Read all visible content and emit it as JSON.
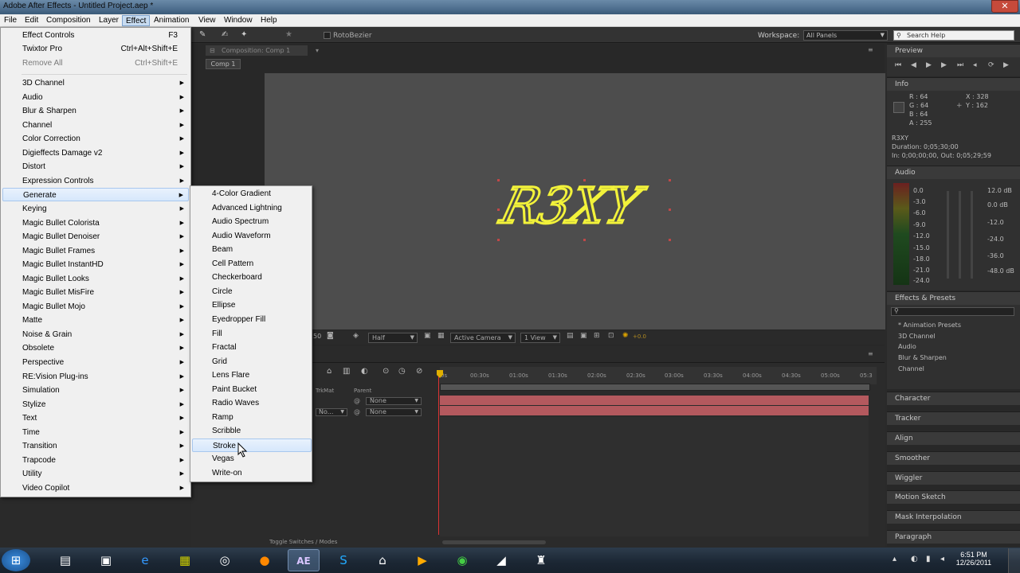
{
  "window": {
    "title": "Adobe After Effects - Untitled Project.aep *",
    "close": "✕"
  },
  "menubar": [
    "File",
    "Edit",
    "Composition",
    "Layer",
    "Effect",
    "Animation",
    "View",
    "Window",
    "Help"
  ],
  "toolbar": {
    "rotobezier": "RotoBezier",
    "workspace_label": "Workspace:",
    "workspace_value": "All Panels",
    "search_placeholder": "Search Help"
  },
  "comp": {
    "tab": "Composition: Comp 1",
    "breadcrumb": "Comp 1",
    "text": "R3XY"
  },
  "viewer_controls": {
    "resolution": "Half",
    "camera": "Active Camera",
    "views": "1 View",
    "exposure": "+0.0",
    "zoom": "50"
  },
  "timeline": {
    "ticks": [
      "0s",
      "00:30s",
      "01:00s",
      "01:30s",
      "02:00s",
      "02:30s",
      "03:00s",
      "03:30s",
      "04:00s",
      "04:30s",
      "05:00s",
      "05:3"
    ],
    "col_trkmat": "TrkMat",
    "col_parent": "Parent",
    "row1_parent": "None",
    "row2_mode": "No...",
    "row2_parent": "None",
    "toggle": "Toggle Switches / Modes"
  },
  "panels": {
    "preview": "Preview",
    "info": "Info",
    "info_rgb": [
      "R : 64",
      "G : 64",
      "B : 64",
      "A : 255"
    ],
    "info_xy": [
      "X : 328",
      "Y : 162"
    ],
    "info_layer": "R3XY",
    "info_duration": "Duration: 0;05;30;00",
    "info_inout": "In: 0;00;00;00, Out: 0;05;29;59",
    "audio": "Audio",
    "audio_left": [
      "0.0",
      "-3.0",
      "-6.0",
      "-9.0",
      "-12.0",
      "-15.0",
      "-18.0",
      "-21.0",
      "-24.0"
    ],
    "audio_right": [
      "12.0 dB",
      "0.0 dB",
      "-12.0",
      "-24.0",
      "-36.0",
      "-48.0 dB"
    ],
    "effects_presets": "Effects & Presets",
    "effects_list": [
      "* Animation Presets",
      "3D Channel",
      "Audio",
      "Blur & Sharpen",
      "Channel"
    ],
    "stacked": [
      "Character",
      "Tracker",
      "Align",
      "Smoother",
      "Wiggler",
      "Motion Sketch",
      "Mask Interpolation",
      "Paragraph"
    ]
  },
  "effect_menu": {
    "top": [
      {
        "label": "Effect Controls",
        "shortcut": "F3",
        "disabled": false
      },
      {
        "label": "Twixtor Pro",
        "shortcut": "Ctrl+Alt+Shift+E",
        "disabled": false
      },
      {
        "label": "Remove All",
        "shortcut": "Ctrl+Shift+E",
        "disabled": true
      }
    ],
    "categories": [
      "3D Channel",
      "Audio",
      "Blur & Sharpen",
      "Channel",
      "Color Correction",
      "Digieffects Damage v2",
      "Distort",
      "Expression Controls",
      "Generate",
      "Keying",
      "Magic Bullet Colorista",
      "Magic Bullet Denoiser",
      "Magic Bullet Frames",
      "Magic Bullet InstantHD",
      "Magic Bullet Looks",
      "Magic Bullet MisFire",
      "Magic Bullet Mojo",
      "Matte",
      "Noise & Grain",
      "Obsolete",
      "Perspective",
      "RE:Vision Plug-ins",
      "Simulation",
      "Stylize",
      "Text",
      "Time",
      "Transition",
      "Trapcode",
      "Utility",
      "Video Copilot"
    ],
    "selected": "Generate",
    "arrow": "▶"
  },
  "generate_menu": {
    "items": [
      "4-Color Gradient",
      "Advanced Lightning",
      "Audio Spectrum",
      "Audio Waveform",
      "Beam",
      "Cell Pattern",
      "Checkerboard",
      "Circle",
      "Ellipse",
      "Eyedropper Fill",
      "Fill",
      "Fractal",
      "Grid",
      "Lens Flare",
      "Paint Bucket",
      "Radio Waves",
      "Ramp",
      "Scribble",
      "Stroke",
      "Vegas",
      "Write-on"
    ],
    "hovered": "Stroke"
  },
  "taskbar": {
    "time": "6:51 PM",
    "date": "12/26/2011",
    "ae_label": "AE"
  },
  "colors": {
    "accent": "#c8dcf1",
    "stroke_text": "#f2f23a",
    "layer_bar": "#b4595e"
  }
}
